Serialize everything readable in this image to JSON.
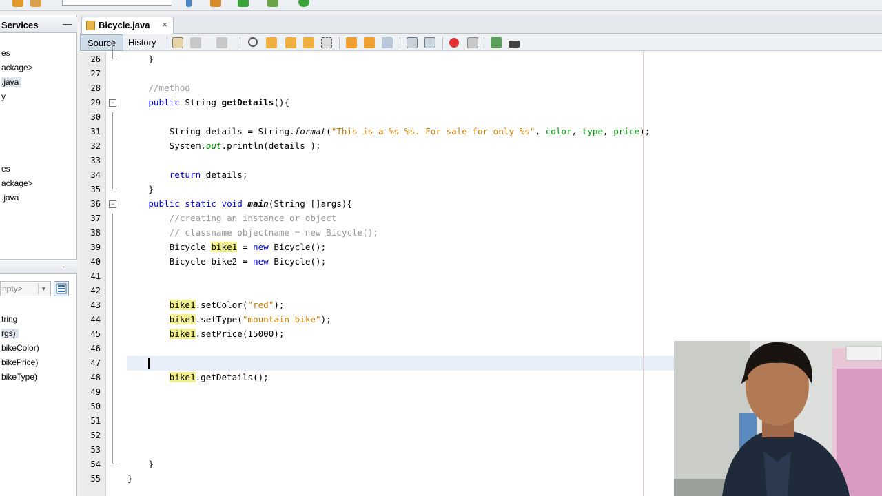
{
  "left_panel": {
    "title": "Services",
    "minimize": "—",
    "tree_items": [
      {
        "text": "es",
        "selected": false
      },
      {
        "text": "ackage>",
        "selected": false
      },
      {
        "text": ".java",
        "selected": true
      },
      {
        "text": "y",
        "selected": false
      },
      {
        "text": "es",
        "selected": false
      },
      {
        "text": "ackage>",
        "selected": false
      },
      {
        "text": ".java",
        "selected": false
      }
    ],
    "navigator_minimize": "—",
    "filter_value": "npty>",
    "members": [
      {
        "text": "tring",
        "selected": false
      },
      {
        "text": "rgs)",
        "selected": true
      },
      {
        "text": "bikeColor)",
        "selected": false
      },
      {
        "text": "bikePrice)",
        "selected": false
      },
      {
        "text": "bikeType)",
        "selected": false
      }
    ]
  },
  "editor": {
    "tab_label": "Bicycle.java",
    "tab_close": "×",
    "source_label": "Source",
    "history_label": "History",
    "caret_line": 47,
    "lines": [
      {
        "n": "26",
        "parts": [
          {
            "t": "    }"
          }
        ]
      },
      {
        "n": "27",
        "parts": []
      },
      {
        "n": "28",
        "parts": [
          {
            "t": "    "
          },
          {
            "t": "//method",
            "c": "cm"
          }
        ]
      },
      {
        "n": "29",
        "parts": [
          {
            "t": "    "
          },
          {
            "t": "public",
            "c": "kw"
          },
          {
            "t": " String "
          },
          {
            "t": "getDetails",
            "c": "b"
          },
          {
            "t": "(){"
          }
        ]
      },
      {
        "n": "30",
        "parts": []
      },
      {
        "n": "31",
        "parts": [
          {
            "t": "        String details = String."
          },
          {
            "t": "format",
            "c": "it"
          },
          {
            "t": "("
          },
          {
            "t": "\"This is a %s %s. For sale for only %s\"",
            "c": "str"
          },
          {
            "t": ", "
          },
          {
            "t": "color",
            "c": "fld"
          },
          {
            "t": ", "
          },
          {
            "t": "type",
            "c": "fld"
          },
          {
            "t": ", "
          },
          {
            "t": "price",
            "c": "fld"
          },
          {
            "t": ");"
          }
        ]
      },
      {
        "n": "32",
        "parts": [
          {
            "t": "        System."
          },
          {
            "t": "out",
            "c": "fld it"
          },
          {
            "t": ".println(details );"
          }
        ]
      },
      {
        "n": "33",
        "parts": []
      },
      {
        "n": "34",
        "parts": [
          {
            "t": "        "
          },
          {
            "t": "return",
            "c": "kw"
          },
          {
            "t": " details;"
          }
        ]
      },
      {
        "n": "35",
        "parts": [
          {
            "t": "    }"
          }
        ]
      },
      {
        "n": "36",
        "parts": [
          {
            "t": "    "
          },
          {
            "t": "public static void",
            "c": "kw"
          },
          {
            "t": " "
          },
          {
            "t": "main",
            "c": "bi"
          },
          {
            "t": "(String []args){"
          }
        ]
      },
      {
        "n": "37",
        "parts": [
          {
            "t": "        "
          },
          {
            "t": "//creating an instance or object",
            "c": "cm"
          }
        ]
      },
      {
        "n": "38",
        "parts": [
          {
            "t": "        "
          },
          {
            "t": "// classname objectname = new Bicycle();",
            "c": "cm"
          }
        ]
      },
      {
        "n": "39",
        "parts": [
          {
            "t": "        Bicycle "
          },
          {
            "t": "bike1",
            "c": "hl"
          },
          {
            "t": " = "
          },
          {
            "t": "new",
            "c": "kw"
          },
          {
            "t": " Bicycle();"
          }
        ]
      },
      {
        "n": "40",
        "parts": [
          {
            "t": "        Bicycle "
          },
          {
            "t": "bike2",
            "c": "uw"
          },
          {
            "t": " = "
          },
          {
            "t": "new",
            "c": "kw"
          },
          {
            "t": " Bicycle();"
          }
        ]
      },
      {
        "n": "41",
        "parts": []
      },
      {
        "n": "42",
        "parts": []
      },
      {
        "n": "43",
        "parts": [
          {
            "t": "        "
          },
          {
            "t": "bike1",
            "c": "hl"
          },
          {
            "t": ".setColor("
          },
          {
            "t": "\"red\"",
            "c": "str"
          },
          {
            "t": ");"
          }
        ]
      },
      {
        "n": "44",
        "parts": [
          {
            "t": "        "
          },
          {
            "t": "bike1",
            "c": "hl"
          },
          {
            "t": ".setType("
          },
          {
            "t": "\"mountain bike\"",
            "c": "str"
          },
          {
            "t": ");"
          }
        ]
      },
      {
        "n": "45",
        "parts": [
          {
            "t": "        "
          },
          {
            "t": "bike1",
            "c": "hl"
          },
          {
            "t": ".setPrice(15000);"
          }
        ]
      },
      {
        "n": "46",
        "parts": []
      },
      {
        "n": "47",
        "parts": [
          {
            "t": "    "
          },
          {
            "caret": true
          }
        ]
      },
      {
        "n": "48",
        "parts": [
          {
            "t": "        "
          },
          {
            "t": "bike1",
            "c": "hl"
          },
          {
            "t": ".getDetails();"
          }
        ]
      },
      {
        "n": "49",
        "parts": []
      },
      {
        "n": "50",
        "parts": []
      },
      {
        "n": "51",
        "parts": []
      },
      {
        "n": "52",
        "parts": []
      },
      {
        "n": "53",
        "parts": []
      },
      {
        "n": "54",
        "parts": [
          {
            "t": "    }"
          }
        ]
      },
      {
        "n": "55",
        "parts": [
          {
            "t": "}"
          }
        ]
      }
    ]
  },
  "colors": {
    "keyword": "#0000e6",
    "comment": "#969696",
    "string": "#ce7b00",
    "field": "#009900",
    "occurrence_highlight": "#f3f090"
  }
}
